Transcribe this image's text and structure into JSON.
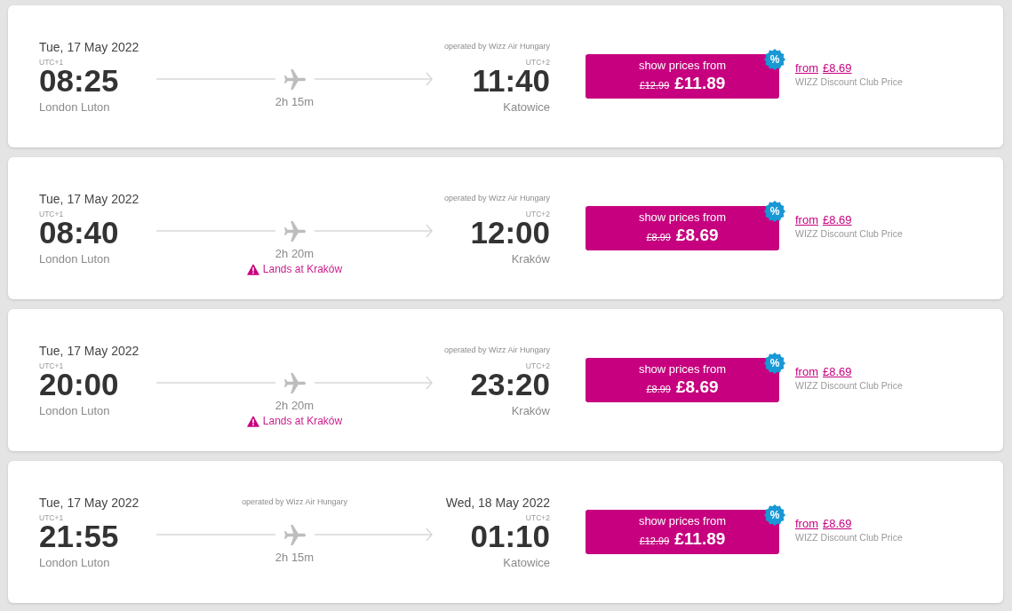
{
  "flights": [
    {
      "departure": {
        "date": "Tue, 17 May 2022",
        "timezone": "UTC+1",
        "time": "08:25",
        "airport": "London Luton"
      },
      "operator": "operated by Wizz Air Hungary",
      "duration": "2h 15m",
      "arrival": {
        "timezone": "UTC+2",
        "time": "11:40",
        "airport": "Katowice"
      },
      "price_button": {
        "label": "show prices from",
        "old_price": "£12.99",
        "price": "£11.89",
        "badge": "%"
      },
      "club_price": {
        "prefix": "from",
        "price": "£8.69",
        "label": "WIZZ Discount Club Price"
      }
    },
    {
      "departure": {
        "date": "Tue, 17 May 2022",
        "timezone": "UTC+1",
        "time": "08:40",
        "airport": "London Luton"
      },
      "operator": "operated by Wizz Air Hungary",
      "duration": "2h 20m",
      "notice": "Lands at Kraków",
      "arrival": {
        "timezone": "UTC+2",
        "time": "12:00",
        "airport": "Kraków"
      },
      "price_button": {
        "label": "show prices from",
        "old_price": "£8.99",
        "price": "£8.69",
        "badge": "%"
      },
      "club_price": {
        "prefix": "from",
        "price": "£8.69",
        "label": "WIZZ Discount Club Price"
      }
    },
    {
      "departure": {
        "date": "Tue, 17 May 2022",
        "timezone": "UTC+1",
        "time": "20:00",
        "airport": "London Luton"
      },
      "operator": "operated by Wizz Air Hungary",
      "duration": "2h 20m",
      "notice": "Lands at Kraków",
      "arrival": {
        "timezone": "UTC+2",
        "time": "23:20",
        "airport": "Kraków"
      },
      "price_button": {
        "label": "show prices from",
        "old_price": "£8.99",
        "price": "£8.69",
        "badge": "%"
      },
      "club_price": {
        "prefix": "from",
        "price": "£8.69",
        "label": "WIZZ Discount Club Price"
      }
    },
    {
      "departure": {
        "date": "Tue, 17 May 2022",
        "timezone": "UTC+1",
        "time": "21:55",
        "airport": "London Luton"
      },
      "operator": "operated by Wizz Air Hungary",
      "duration": "2h 15m",
      "arrival": {
        "date": "Wed, 18 May 2022",
        "timezone": "UTC+2",
        "time": "01:10",
        "airport": "Katowice"
      },
      "price_button": {
        "label": "show prices from",
        "old_price": "£12.99",
        "price": "£11.89",
        "badge": "%"
      },
      "club_price": {
        "prefix": "from",
        "price": "£8.69",
        "label": "WIZZ Discount Club Price"
      }
    }
  ]
}
